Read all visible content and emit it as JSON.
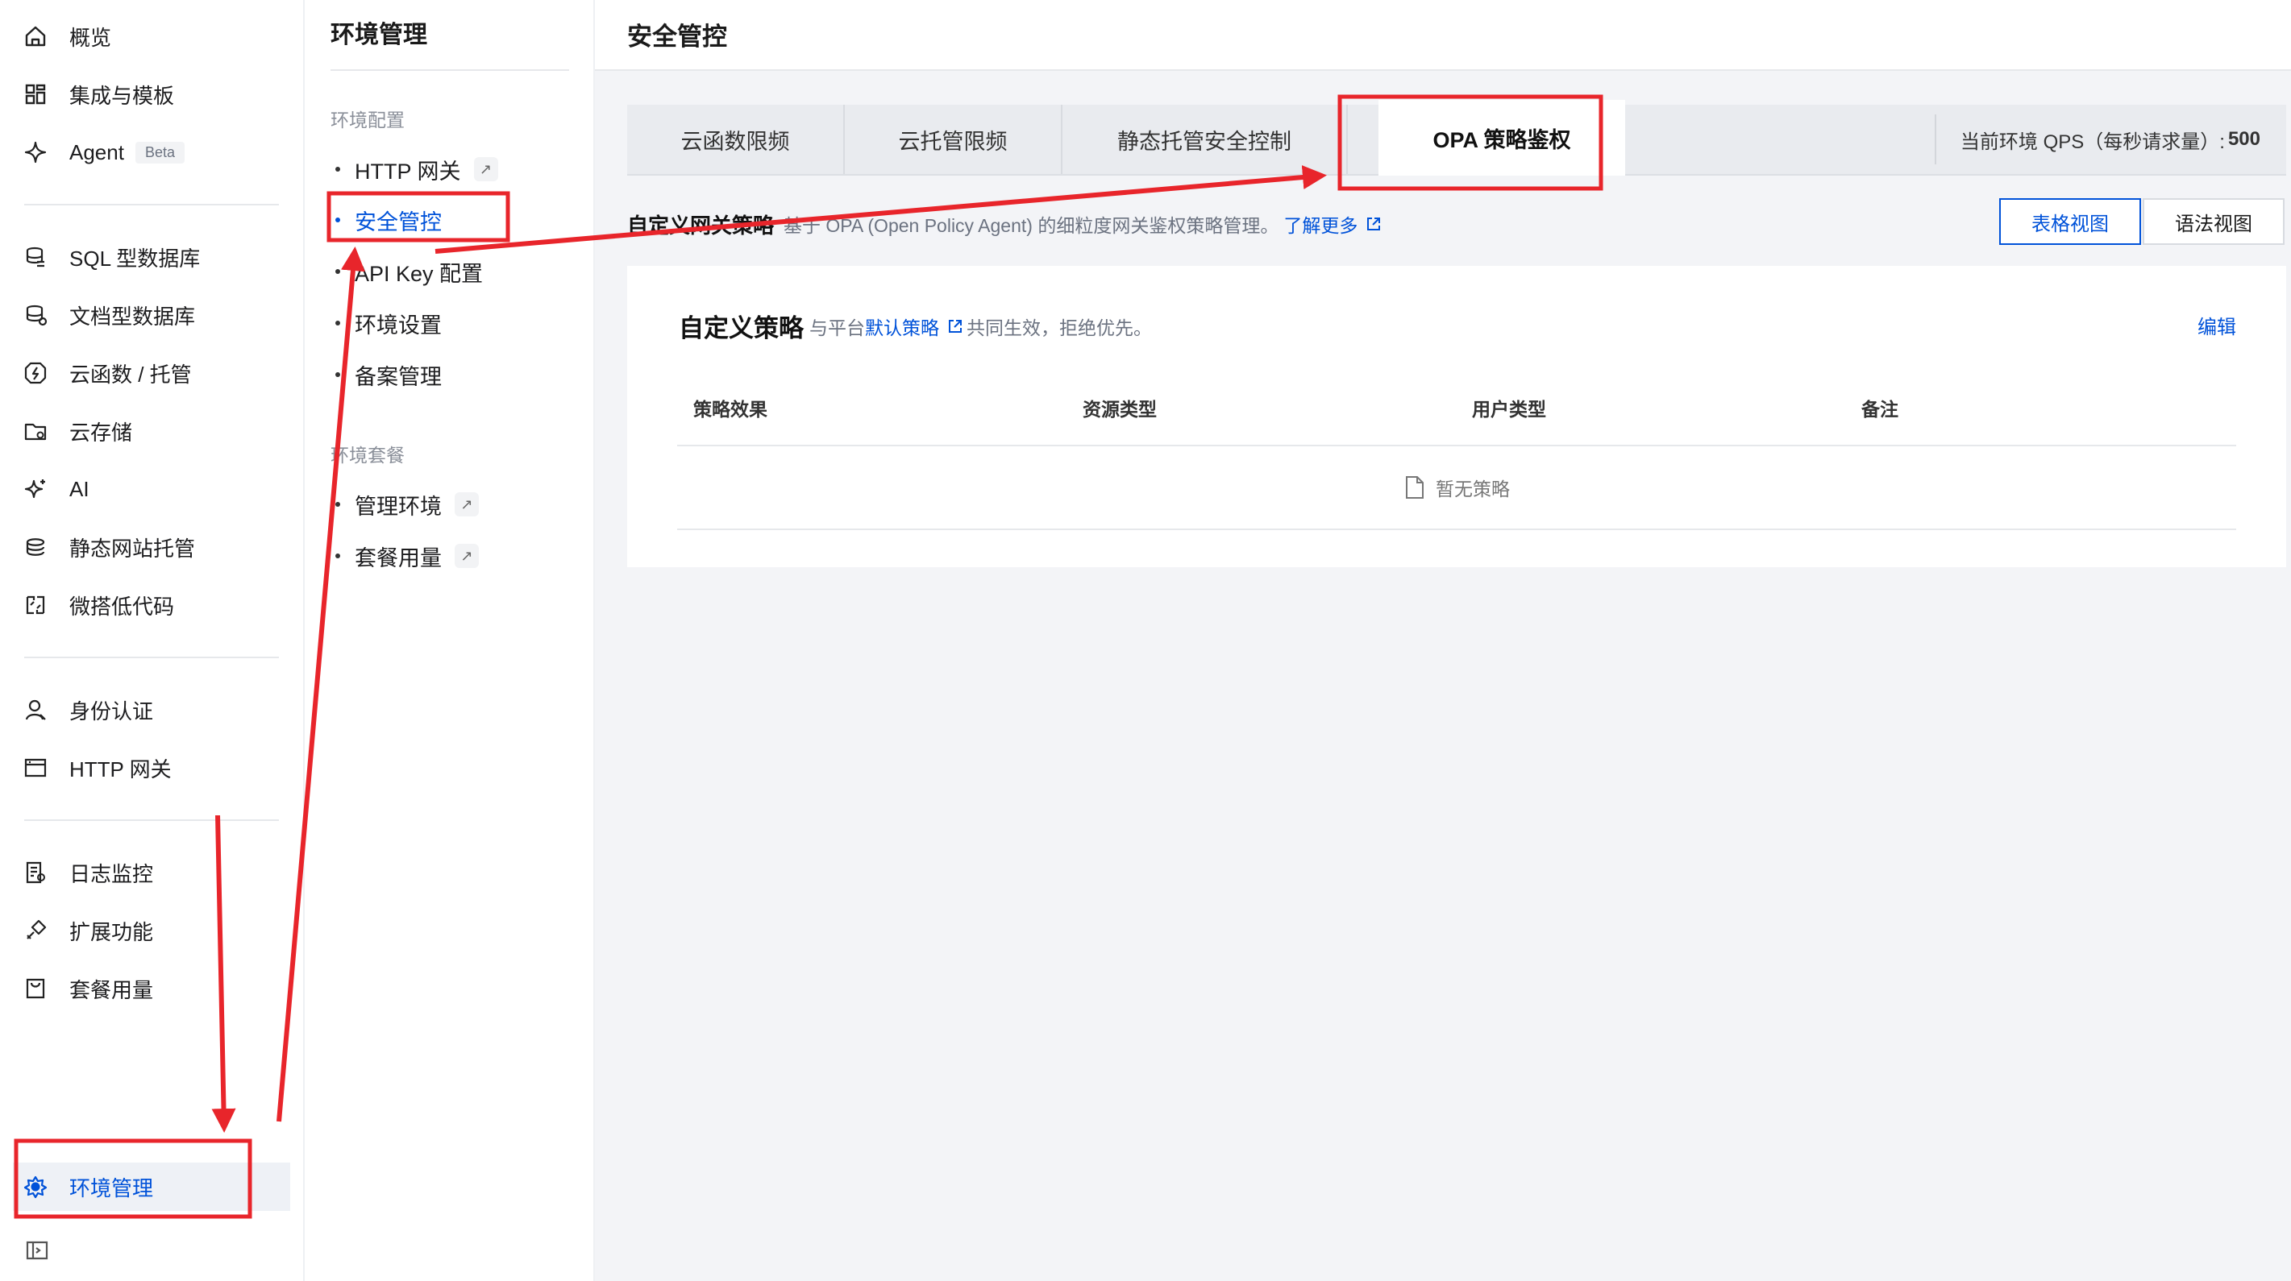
{
  "leftnav": {
    "items": [
      {
        "label": "概览",
        "icon": "home-icon"
      },
      {
        "label": "集成与模板",
        "icon": "grid-icon"
      },
      {
        "label": "Agent",
        "icon": "sparkle-icon",
        "badge": "Beta"
      },
      {
        "label": "SQL 型数据库",
        "icon": "database-icon"
      },
      {
        "label": "文档型数据库",
        "icon": "document-database-icon"
      },
      {
        "label": "云函数 / 托管",
        "icon": "function-icon"
      },
      {
        "label": "云存储",
        "icon": "folder-icon"
      },
      {
        "label": "AI",
        "icon": "ai-sparkle-icon"
      },
      {
        "label": "静态网站托管",
        "icon": "hosting-icon"
      },
      {
        "label": "微搭低代码",
        "icon": "lowcode-icon"
      },
      {
        "label": "身份认证",
        "icon": "user-icon"
      },
      {
        "label": "HTTP 网关",
        "icon": "browser-window-icon"
      },
      {
        "label": "日志监控",
        "icon": "log-icon"
      },
      {
        "label": "扩展功能",
        "icon": "extension-icon"
      },
      {
        "label": "套餐用量",
        "icon": "package-icon"
      },
      {
        "label": "环境管理",
        "icon": "environment-gear-icon"
      }
    ],
    "active": "环境管理",
    "collapse_icon": "sidebar-collapse-icon"
  },
  "subnav": {
    "title": "环境管理",
    "groups": [
      {
        "label": "环境配置",
        "items": [
          {
            "label": "HTTP 网关",
            "external": true
          },
          {
            "label": "安全管控",
            "active": true
          },
          {
            "label": "API Key 配置"
          },
          {
            "label": "环境设置"
          },
          {
            "label": "备案管理"
          }
        ]
      },
      {
        "label": "环境套餐",
        "items": [
          {
            "label": "管理环境",
            "external": true
          },
          {
            "label": "套餐用量",
            "external": true
          }
        ]
      }
    ]
  },
  "main": {
    "title": "安全管控",
    "tabs": [
      {
        "label": "云函数限频"
      },
      {
        "label": "云托管限频"
      },
      {
        "label": "静态托管安全控制"
      },
      {
        "label": "OPA 策略鉴权",
        "active": true
      }
    ],
    "qps_label": "当前环境 QPS（每秒请求量）:",
    "qps_value": "500",
    "section_title": "自定义网关策略",
    "section_desc": "基于 OPA (Open Policy Agent) 的细粒度网关鉴权策略管理。",
    "learn_more": "了解更多",
    "view_buttons": [
      {
        "label": "表格视图",
        "active": true
      },
      {
        "label": "语法视图"
      }
    ],
    "card": {
      "title": "自定义策略",
      "subtitle_prefix": "与平台",
      "subtitle_link": "默认策略",
      "subtitle_suffix": "共同生效，拒绝优先。",
      "edit": "编辑",
      "columns": [
        "策略效果",
        "资源类型",
        "用户类型",
        "备注"
      ],
      "empty_text": "暂无策略"
    }
  },
  "annotation_color": "#e8252b"
}
